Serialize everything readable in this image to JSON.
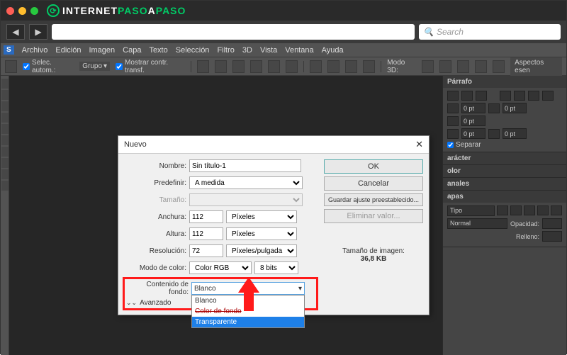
{
  "browser": {
    "logo_part1": "INTERNET",
    "logo_part2": "PASO",
    "logo_part3": "A",
    "logo_part4": "PASO",
    "search_placeholder": "Search"
  },
  "menubar": {
    "ps": "S",
    "items": [
      "Archivo",
      "Edición",
      "Imagen",
      "Capa",
      "Texto",
      "Selección",
      "Filtro",
      "3D",
      "Vista",
      "Ventana",
      "Ayuda"
    ]
  },
  "optbar": {
    "auto_select": "Selec. autom.:",
    "group": "Grupo",
    "transform": "Mostrar contr. transf.",
    "mode3d": "Modo 3D:",
    "aspects": "Aspectos esen"
  },
  "panels": {
    "parrafo": {
      "title": "Párrafo",
      "pt": "0 pt",
      "separar": "Separar"
    },
    "caracter": "arácter",
    "color": "olor",
    "canales": "anales",
    "capas": {
      "title": "apas",
      "tipo": "Tipo",
      "normal": "Normal",
      "opacidad": "Opacidad:",
      "relleno": "Relleno:"
    }
  },
  "dialog": {
    "title": "Nuevo",
    "labels": {
      "nombre": "Nombre:",
      "predefinir": "Predefinir:",
      "tamano": "Tamaño:",
      "anchura": "Anchura:",
      "altura": "Altura:",
      "resolucion": "Resolución:",
      "modo_color": "Modo de color:",
      "contenido_fondo": "Contenido de fondo:",
      "avanzado": "Avanzado"
    },
    "values": {
      "nombre": "Sin título-1",
      "predefinir": "A medida",
      "anchura": "112",
      "altura": "112",
      "resolucion": "72",
      "unidad_dim": "Píxeles",
      "unidad_res": "Píxeles/pulgada",
      "modo_color": "Color RGB",
      "bits": "8 bits",
      "fondo_selected": "Blanco"
    },
    "fondo_options": [
      "Blanco",
      "Color de fondo",
      "Transparente"
    ],
    "buttons": {
      "ok": "OK",
      "cancel": "Cancelar",
      "save_preset": "Guardar ajuste preestablecido...",
      "delete_preset": "Eliminar valor..."
    },
    "size_label": "Tamaño de imagen:",
    "size_value": "36,8 KB"
  }
}
